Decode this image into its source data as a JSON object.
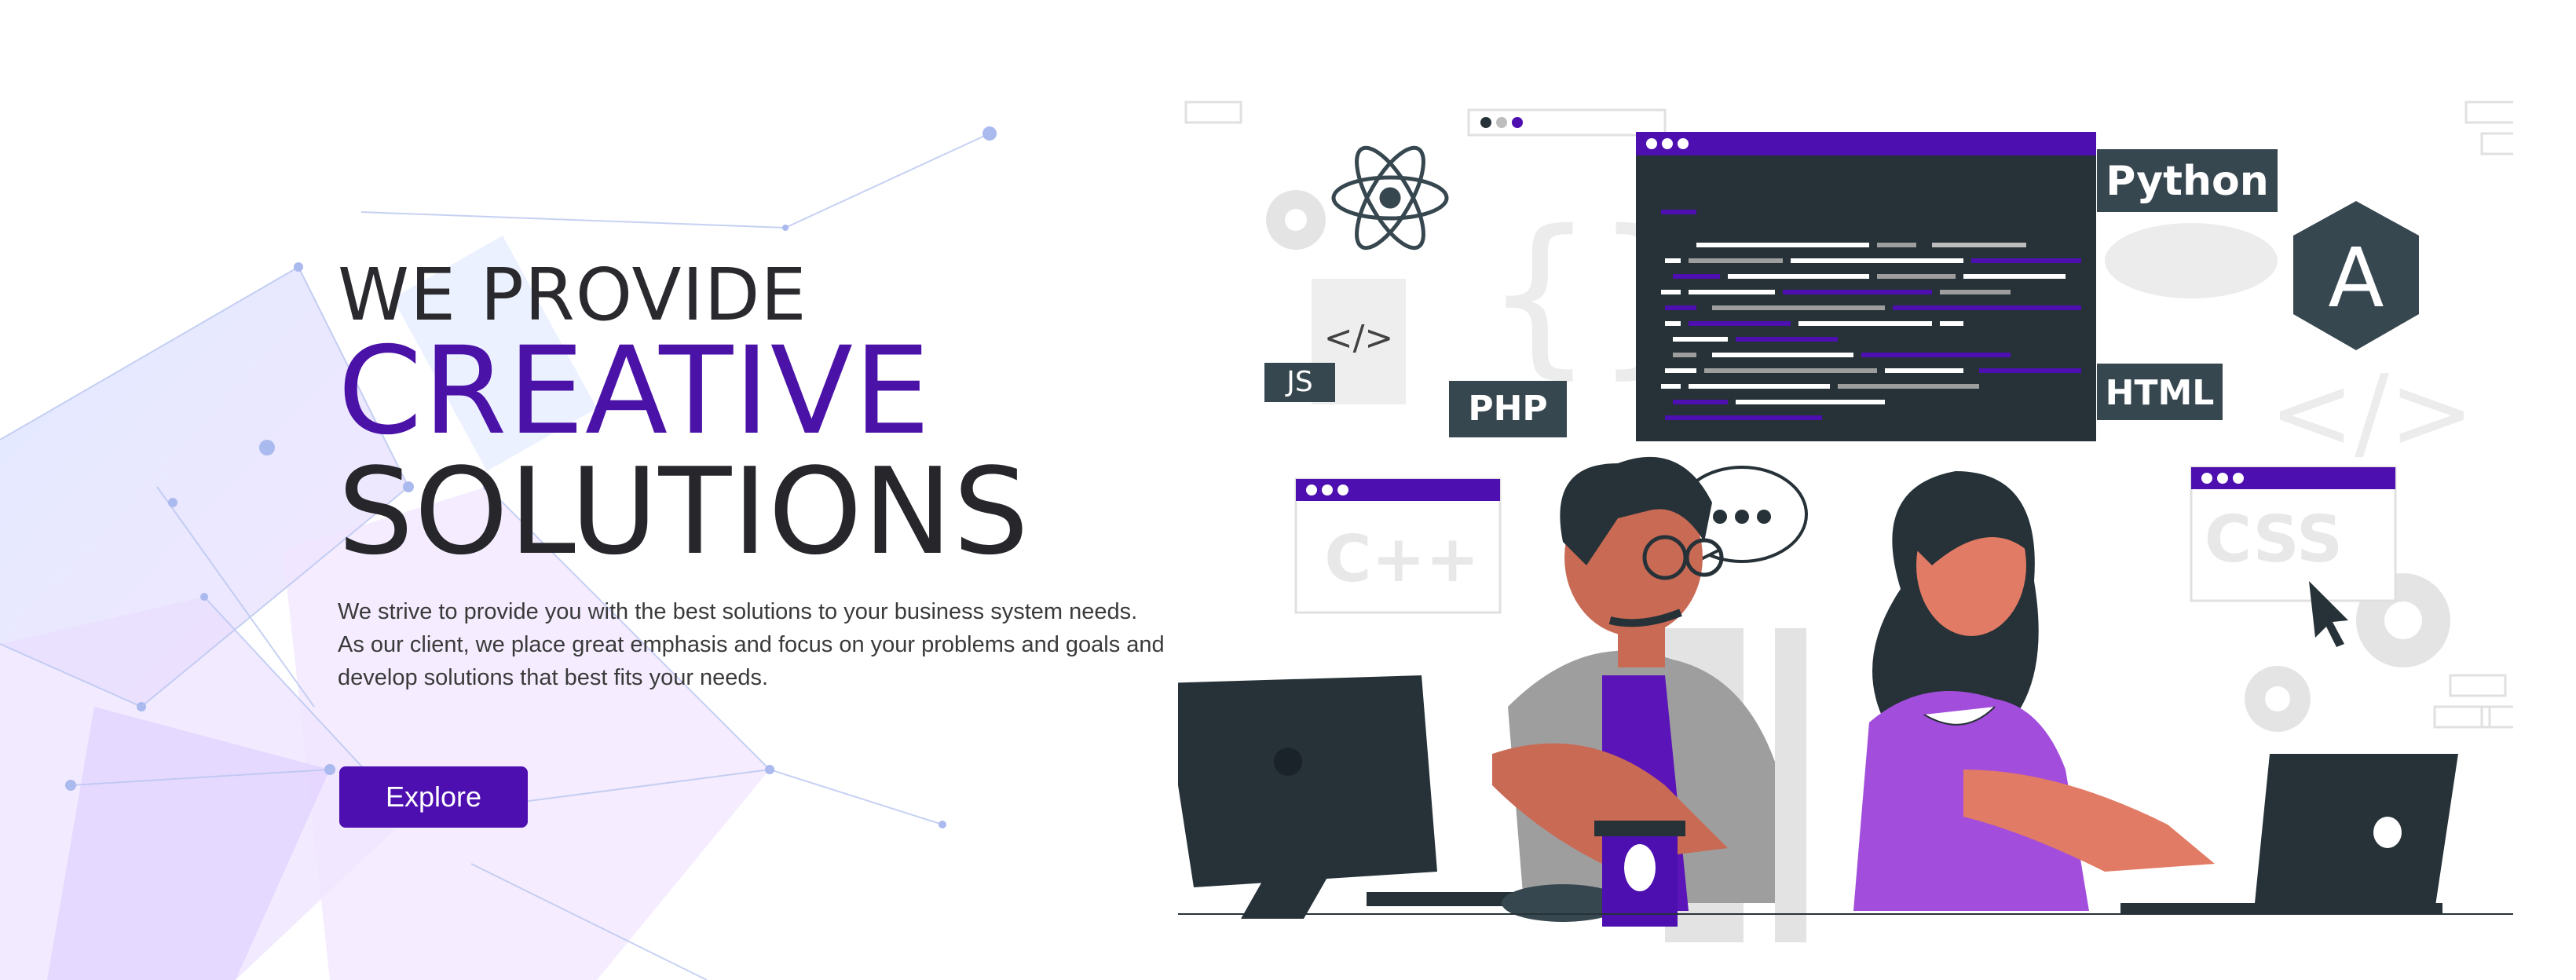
{
  "hero": {
    "line1": "WE PROVIDE",
    "line2": "CREATIVE",
    "line3": "SOLUTIONS",
    "description": [
      "We strive to provide you with the best solutions to your business system needs.",
      "As our client, we place great emphasis and focus on your problems and goals and",
      "develop solutions that best fits your needs."
    ],
    "button_label": "Explore"
  },
  "illustration": {
    "tags": {
      "js": "JS",
      "php": "PHP",
      "python": "Python",
      "html": "HTML",
      "cpp": "C++",
      "css": "CSS",
      "angular": "A",
      "code_glyph": "</>"
    }
  },
  "colors": {
    "accent": "#4d0fb0",
    "dark_panel": "#263238",
    "skin": "#c96a55",
    "purple_shirt": "#a24ddc"
  }
}
